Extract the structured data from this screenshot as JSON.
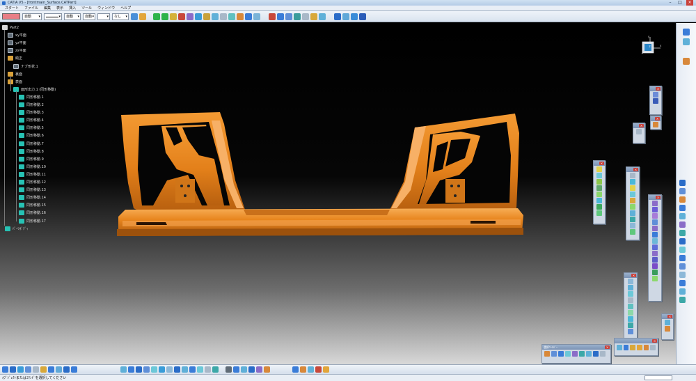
{
  "window": {
    "title": "CATIA V5 - [frontmain_Surface.CATPart]",
    "controls": [
      "–",
      "□",
      "×"
    ]
  },
  "menu": [
    "スタート",
    "ファイル",
    "編集",
    "表示",
    "挿入",
    "ツール",
    "ウィンドウ",
    "ヘルプ"
  ],
  "toolbar_top": {
    "swatch_color": "#e87e86",
    "combos": [
      "自動",
      "",
      "自動",
      "自動",
      "なし"
    ]
  },
  "tree": {
    "root": "Part2",
    "planes": [
      "xy平面",
      "yz平面",
      "zx平面"
    ],
    "body1": "純正",
    "body1_child": "ナブ形状.1",
    "body2": "裏面",
    "body3": "表面",
    "pattern": "面形出力.1 (同形移動)",
    "features": [
      "同形移動.1",
      "同形移動.2",
      "同形移動.3",
      "同形移動.4",
      "同形移動.5",
      "同形移動.6",
      "同形移動.7",
      "同形移動.8",
      "同形移動.9",
      "同形移動.10",
      "同形移動.11",
      "同形移動.12",
      "同形移動.13",
      "同形移動.14",
      "同形移動.15",
      "同形移動.16",
      "同形移動.17"
    ],
    "last": "ﾊﾟｰﾂﾎﾞﾃﾞｨ"
  },
  "palettes": {
    "floating_title": "選択ﾂｰﾙﾊﾞｰ"
  },
  "status": {
    "message": "ｵﾌﾞｼﾞｪｸﾄまたはｺﾏﾝﾄﾞを選択してください"
  },
  "colors": {
    "part": "#e88a1f",
    "part_dark": "#b5600d",
    "part_light": "#f6a84a",
    "background_top": "#000000",
    "background_bottom": "#d8d8d8"
  }
}
